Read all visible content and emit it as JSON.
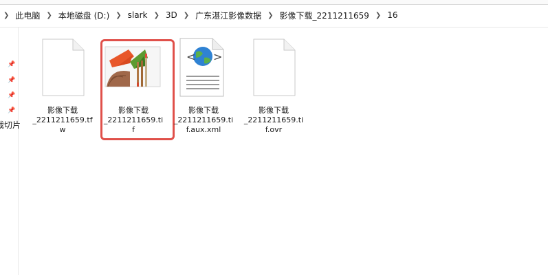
{
  "breadcrumb": [
    "此电脑",
    "本地磁盘 (D:)",
    "slark",
    "3D",
    "广东湛江影像数据",
    "影像下载_2211211659",
    "16"
  ],
  "sidebar": {
    "label": "裁切片"
  },
  "files": [
    {
      "name": "影像下载\n_2211211659.tfw",
      "icon": "blank-document-icon"
    },
    {
      "name": "影像下载\n_2211211659.tif",
      "icon": "image-paint-icon",
      "selected": true
    },
    {
      "name": "影像下载\n_2211211659.tif.aux.xml",
      "icon": "xml-globe-document-icon"
    },
    {
      "name": "影像下载\n_2211211659.tif.ovr",
      "icon": "blank-document-icon"
    }
  ],
  "colors": {
    "highlight": "#e0504a"
  }
}
